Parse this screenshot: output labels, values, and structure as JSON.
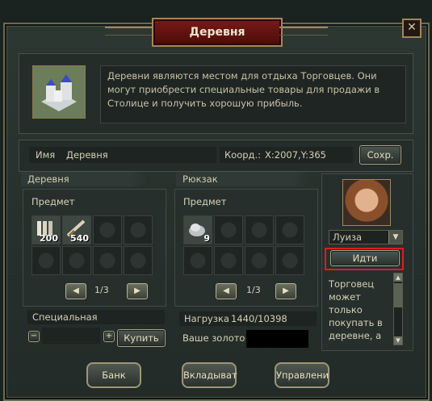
{
  "title": "Деревня",
  "description": "Деревни являются местом для отдыха Торговцев. Они могут приобрести специальные товары для продажи в Столице и получить хорошую прибыль.",
  "info": {
    "name_label": "Имя",
    "name_value": "Деревня",
    "coord_label": "Коорд.:",
    "coord_value": "X:2007,Y:365",
    "save_label": "Сохр."
  },
  "village": {
    "tab_label": "Деревня",
    "item_header": "Предмет",
    "slots": [
      {
        "icon": "bundle-icon",
        "qty": "200"
      },
      {
        "icon": "quill-icon",
        "qty": "540"
      },
      {
        "icon": "",
        "qty": ""
      },
      {
        "icon": "",
        "qty": ""
      },
      {
        "icon": "",
        "qty": ""
      },
      {
        "icon": "",
        "qty": ""
      },
      {
        "icon": "",
        "qty": ""
      },
      {
        "icon": "",
        "qty": ""
      }
    ],
    "page": "1/3",
    "special_label": "Специальная",
    "buy_label": "Купить"
  },
  "backpack": {
    "tab_label": "Рюкзак",
    "item_header": "Предмет",
    "slots": [
      {
        "icon": "ore-icon",
        "qty": "9"
      },
      {
        "icon": "",
        "qty": ""
      },
      {
        "icon": "",
        "qty": ""
      },
      {
        "icon": "",
        "qty": ""
      },
      {
        "icon": "",
        "qty": ""
      },
      {
        "icon": "",
        "qty": ""
      },
      {
        "icon": "",
        "qty": ""
      },
      {
        "icon": "",
        "qty": ""
      }
    ],
    "page": "1/3",
    "load_label": "Нагрузка",
    "load_value": "1440/10398",
    "gold_label": "Ваше золото"
  },
  "merchant": {
    "name": "Луиза",
    "go_label": "Идти",
    "info_text": "Торговец может только покупать в деревне, а"
  },
  "bottom_buttons": [
    "Банк",
    "Вкладыват",
    "Управлени"
  ],
  "colors": {
    "accent_red": "#e11b1b",
    "title_plate": "#7a1a16",
    "gold_border": "#a2865c"
  }
}
